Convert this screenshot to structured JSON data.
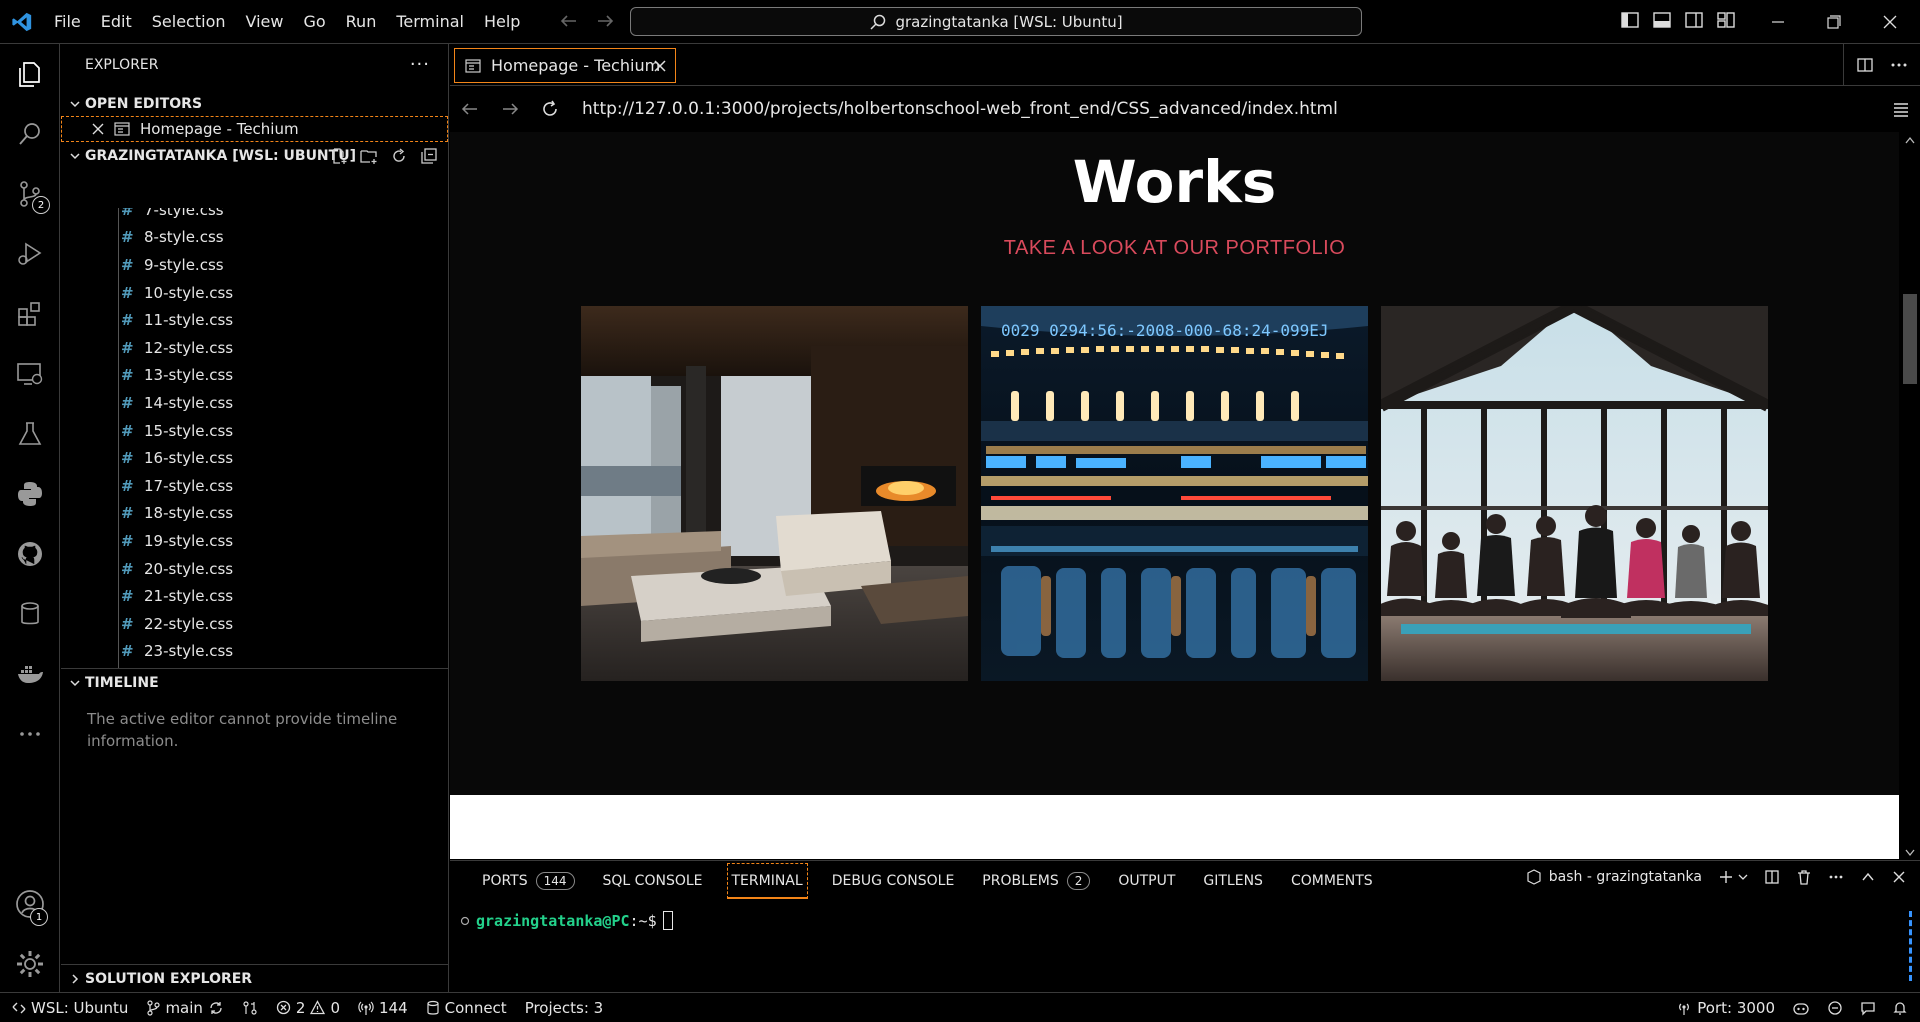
{
  "titlebar": {
    "menu": [
      "File",
      "Edit",
      "Selection",
      "View",
      "Go",
      "Run",
      "Terminal",
      "Help"
    ],
    "command_center": "grazingtatanka [WSL: Ubuntu]"
  },
  "activity": {
    "scm_badge": "2",
    "accounts_badge": "1"
  },
  "sidebar": {
    "title": "EXPLORER",
    "open_editors_label": "OPEN EDITORS",
    "open_editor_item": "Homepage - Techium",
    "workspace_label": "GRAZINGTATANKA [WSL: UBUNTU]",
    "files": [
      "7-style.css",
      "8-style.css",
      "9-style.css",
      "10-style.css",
      "11-style.css",
      "12-style.css",
      "13-style.css",
      "14-style.css",
      "15-style.css",
      "16-style.css",
      "17-style.css",
      "18-style.css",
      "19-style.css",
      "20-style.css",
      "21-style.css",
      "22-style.css",
      "23-style.css"
    ],
    "timeline_label": "TIMELINE",
    "timeline_message": "The active editor cannot provide timeline information.",
    "solution_label": "SOLUTION EXPLORER"
  },
  "editor": {
    "tab_label": "Homepage - Techium",
    "url": "http://127.0.0.1:3000/projects/holbertonschool-web_front_end/CSS_advanced/index.html"
  },
  "webpage": {
    "title": "Works",
    "subtitle": "TAKE A LOOK AT OUR PORTFOLIO",
    "accent_color": "#d94a5c",
    "images": [
      "living-room-photo",
      "city-lights-photo",
      "yoga-class-photo"
    ]
  },
  "panel": {
    "tabs": [
      {
        "label": "PORTS",
        "count": "144"
      },
      {
        "label": "SQL CONSOLE"
      },
      {
        "label": "TERMINAL"
      },
      {
        "label": "DEBUG CONSOLE"
      },
      {
        "label": "PROBLEMS",
        "count": "2"
      },
      {
        "label": "OUTPUT"
      },
      {
        "label": "GITLENS"
      },
      {
        "label": "COMMENTS"
      }
    ],
    "terminal_name": "bash - grazingtatanka",
    "prompt_user": "grazingtatanka@PC",
    "prompt_path": ":~$"
  },
  "statusbar": {
    "remote": "WSL: Ubuntu",
    "branch": "main",
    "errors": "2",
    "warnings": "0",
    "ports": "144",
    "connect": "Connect",
    "projects": "Projects: 3",
    "port": "Port: 3000"
  }
}
